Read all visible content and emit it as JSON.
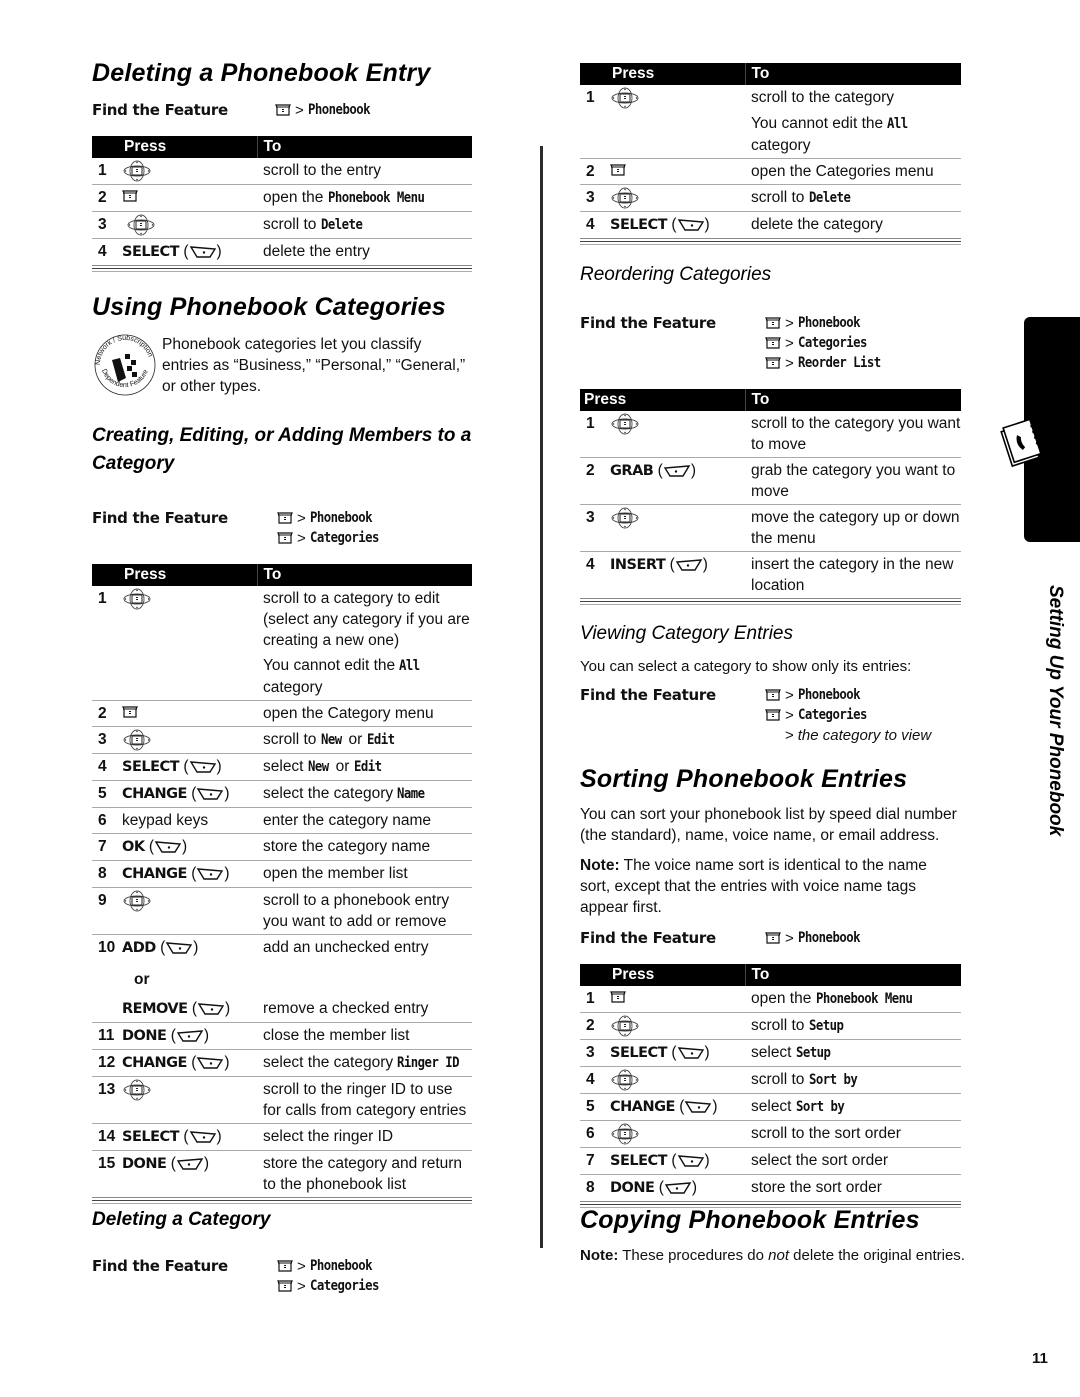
{
  "page": {
    "number": "11",
    "side_title": "Setting Up Your Phonebook",
    "tab_icon": "phonebook-icon"
  },
  "common": {
    "find_feature_label": "Find the Feature",
    "press_header": "Press",
    "to_header": "To",
    "gt": ">",
    "or_label": "or"
  },
  "deleting_entry": {
    "title": "Deleting a Phonebook Entry",
    "paths": [
      {
        "icon": "menu-key-icon",
        "item": "Phonebook"
      }
    ],
    "steps": [
      {
        "num": "1",
        "press_icon": "nav-key-icon",
        "press": "",
        "to": "scroll to the entry",
        "to_emph": ""
      },
      {
        "num": "2",
        "press_icon": "menu-key-icon",
        "press": "",
        "to": "open the ",
        "to_emph": "Phonebook Menu"
      },
      {
        "num": "3",
        "press_icon": "nav-key-icon",
        "press": "",
        "to": "scroll to ",
        "to_emph": "Delete"
      },
      {
        "num": "4",
        "press_icon": "right-soft-key-icon",
        "press": "SELECT",
        "to": "delete the entry",
        "to_emph": ""
      }
    ]
  },
  "using_categories": {
    "title": "Using Phonebook Categories",
    "badge": "network-subscription-dependent-feature-icon",
    "badge_text_top": "Network / Subscription",
    "badge_text_bottom": "Dependent Feature",
    "intro": "Phonebook categories let you classify entries as “Business,” “Personal,” “General,” or other types."
  },
  "creating_editing": {
    "title": "Creating, Editing, or Adding Members to a Category",
    "paths": [
      {
        "icon": "menu-key-icon",
        "item": "Phonebook"
      },
      {
        "icon": "menu-key-icon",
        "item": "Categories"
      }
    ],
    "steps": [
      {
        "num": "1",
        "press_icon": "nav-key-icon",
        "press": "",
        "to": "scroll to a category to edit (select any category if you are creating a new one)",
        "note_pre": "You cannot edit the ",
        "note_emph": "All",
        "note_post": " category"
      },
      {
        "num": "2",
        "press_icon": "menu-key-icon",
        "press": "",
        "to": "open the Category menu"
      },
      {
        "num": "3",
        "press_icon": "nav-key-icon",
        "press": "",
        "to": "scroll to ",
        "emph1": "New",
        "mid": " or ",
        "emph2": "Edit"
      },
      {
        "num": "4",
        "press_icon": "right-soft-key-icon",
        "press": "SELECT",
        "to": "select ",
        "emph1": "New",
        "mid": " or ",
        "emph2": "Edit"
      },
      {
        "num": "5",
        "press_icon": "right-soft-key-icon",
        "press": "CHANGE",
        "to": "select the category ",
        "emph1": "Name"
      },
      {
        "num": "6",
        "press_icon": "",
        "press_plain": "keypad keys",
        "to": "enter the category name"
      },
      {
        "num": "7",
        "press_icon": "right-soft-key-icon",
        "press": "OK",
        "to": "store the category name"
      },
      {
        "num": "8",
        "press_icon": "right-soft-key-icon",
        "press": "CHANGE",
        "to": "open the member list"
      },
      {
        "num": "9",
        "press_icon": "nav-key-icon",
        "press": "",
        "to": "scroll to a phonebook entry you want to add or remove"
      },
      {
        "num": "10",
        "press_icon": "right-soft-key-icon",
        "press": "ADD",
        "to": "add an unchecked entry"
      },
      {
        "num": "",
        "press_icon": "right-soft-key-icon",
        "press": "REMOVE",
        "to": "remove a checked entry"
      },
      {
        "num": "11",
        "press_icon": "left-soft-key-icon",
        "press": "DONE",
        "to": "close the member list"
      },
      {
        "num": "12",
        "press_icon": "right-soft-key-icon",
        "press": "CHANGE",
        "to": "select the category ",
        "emph1": "Ringer ID"
      },
      {
        "num": "13",
        "press_icon": "nav-key-icon",
        "press": "",
        "to": "scroll to the ringer ID to use for calls from category entries"
      },
      {
        "num": "14",
        "press_icon": "right-soft-key-icon",
        "press": "SELECT",
        "to": "select the ringer ID"
      },
      {
        "num": "15",
        "press_icon": "left-soft-key-icon",
        "press": "DONE",
        "to": "store the category and return to the phonebook list"
      }
    ]
  },
  "deleting_category": {
    "title": "Deleting a Category",
    "paths": [
      {
        "icon": "menu-key-icon",
        "item": "Phonebook"
      },
      {
        "icon": "menu-key-icon",
        "item": "Categories"
      }
    ],
    "steps": [
      {
        "num": "1",
        "press_icon": "nav-key-icon",
        "press": "",
        "to": "scroll to the category",
        "note_pre": "You cannot edit the ",
        "note_emph": "All",
        "note_post": " category"
      },
      {
        "num": "2",
        "press_icon": "menu-key-icon",
        "press": "",
        "to": "open the Categories menu"
      },
      {
        "num": "3",
        "press_icon": "nav-key-icon",
        "press": "",
        "to": "scroll to ",
        "emph1": "Delete"
      },
      {
        "num": "4",
        "press_icon": "right-soft-key-icon",
        "press": "SELECT",
        "to": "delete the category"
      }
    ]
  },
  "reordering": {
    "title": "Reordering Categories",
    "paths": [
      {
        "icon": "menu-key-icon",
        "item": "Phonebook"
      },
      {
        "icon": "menu-key-icon",
        "item": "Categories"
      },
      {
        "icon": "menu-key-icon",
        "item": "Reorder List"
      }
    ],
    "steps": [
      {
        "num": "1",
        "press_icon": "nav-key-icon",
        "press": "",
        "to": "scroll to the category you want to move"
      },
      {
        "num": "2",
        "press_icon": "left-soft-key-icon",
        "press": "GRAB",
        "to": "grab the category you want to move"
      },
      {
        "num": "3",
        "press_icon": "nav-key-icon",
        "press": "",
        "to": "move the category up or down the menu"
      },
      {
        "num": "4",
        "press_icon": "left-soft-key-icon",
        "press": "INSERT",
        "to": "insert the category in the new location"
      }
    ]
  },
  "viewing": {
    "title": "Viewing Category Entries",
    "intro": "You can select a category to show only its entries:",
    "paths": [
      {
        "icon": "menu-key-icon",
        "item": "Phonebook"
      },
      {
        "icon": "menu-key-icon",
        "item": "Categories"
      }
    ],
    "path_tail": "the category to view"
  },
  "sorting": {
    "title": "Sorting Phonebook Entries",
    "intro": "You can sort your phonebook list by speed dial number (the standard), name, voice name, or email address.",
    "note_label": "Note:",
    "note": " The voice name sort is identical to the name sort, except that the entries with voice name tags appear first.",
    "paths": [
      {
        "icon": "menu-key-icon",
        "item": "Phonebook"
      }
    ],
    "steps": [
      {
        "num": "1",
        "press_icon": "menu-key-icon",
        "press": "",
        "to": "open the ",
        "emph1": "Phonebook Menu"
      },
      {
        "num": "2",
        "press_icon": "nav-key-icon",
        "press": "",
        "to": "scroll to ",
        "emph1": "Setup"
      },
      {
        "num": "3",
        "press_icon": "right-soft-key-icon",
        "press": "SELECT",
        "to": "select ",
        "emph1": "Setup"
      },
      {
        "num": "4",
        "press_icon": "nav-key-icon",
        "press": "",
        "to": "scroll to ",
        "emph1": "Sort by"
      },
      {
        "num": "5",
        "press_icon": "right-soft-key-icon",
        "press": "CHANGE",
        "to": "select ",
        "emph1": "Sort by"
      },
      {
        "num": "6",
        "press_icon": "nav-key-icon",
        "press": "",
        "to": "scroll to the sort order"
      },
      {
        "num": "7",
        "press_icon": "right-soft-key-icon",
        "press": "SELECT",
        "to": "select the sort order"
      },
      {
        "num": "8",
        "press_icon": "left-soft-key-icon",
        "press": "DONE",
        "to": "store the sort order"
      }
    ]
  },
  "copying": {
    "title": "Copying Phonebook Entries",
    "note_label": "Note:",
    "note_pre": " These procedures do ",
    "note_emph": "not",
    "note_post": " delete the original entries."
  }
}
